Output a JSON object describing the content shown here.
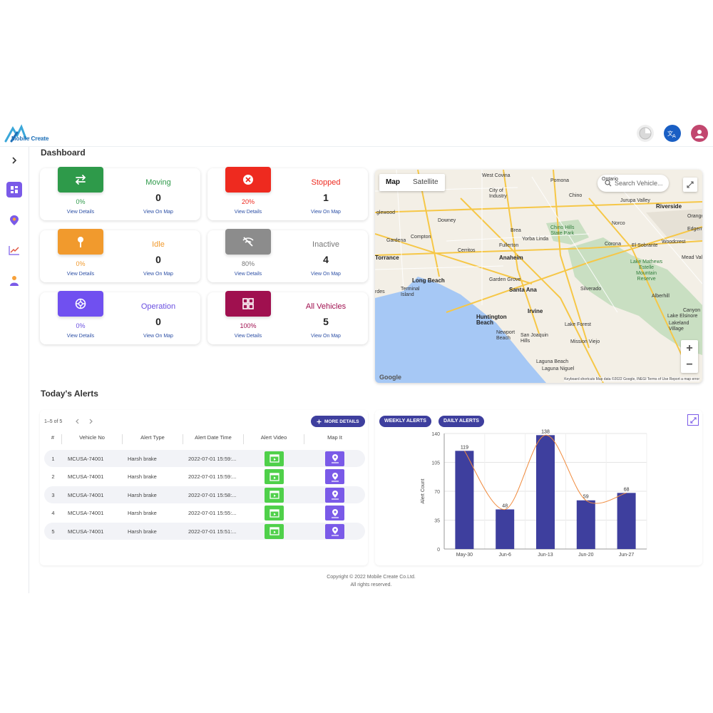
{
  "brand": {
    "name": "Mobile Create",
    "tagline": "— — — — —",
    "accent": "#1e6fb7"
  },
  "header": {
    "icons": [
      "theme-icon",
      "translate-icon",
      "account-icon"
    ]
  },
  "sidebar": {
    "items": [
      "chevron-right-icon",
      "dashboard-icon",
      "location-icon",
      "trend-icon",
      "people-icon"
    ]
  },
  "dashboard": {
    "title": "Dashboard"
  },
  "cards": [
    {
      "label": "Moving",
      "count": "0",
      "percent": "0%",
      "view_details": "View Details",
      "view_map": "View On Map",
      "color": "#2e9a4a",
      "label_color": "#2e9a4a"
    },
    {
      "label": "Stopped",
      "count": "1",
      "percent": "20%",
      "view_details": "View Details",
      "view_map": "View On Map",
      "color": "#ee2a1f",
      "label_color": "#ee2a1f"
    },
    {
      "label": "Idle",
      "count": "0",
      "percent": "0%",
      "view_details": "View Details",
      "view_map": "View On Map",
      "color": "#f19a2d",
      "label_color": "#f19a2d"
    },
    {
      "label": "Inactive",
      "count": "4",
      "percent": "80%",
      "view_details": "View Details",
      "view_map": "View On Map",
      "color": "#8c8c8c",
      "label_color": "#777777"
    },
    {
      "label": "Operation",
      "count": "0",
      "percent": "0%",
      "view_details": "View Details",
      "view_map": "View On Map",
      "color": "#7050f0",
      "label_color": "#6a4fe0"
    },
    {
      "label": "All Vehicles",
      "count": "5",
      "percent": "100%",
      "view_details": "View Details",
      "view_map": "View On Map",
      "color": "#a0104f",
      "label_color": "#a0104f"
    }
  ],
  "map": {
    "type_map": "Map",
    "type_satellite": "Satellite",
    "search_placeholder": "Search Vehicle...",
    "zoom_in": "+",
    "zoom_out": "−",
    "logo": "Google",
    "footer": "Keyboard shortcuts   Map data ©2022 Google, INEGI   Terms of Use   Report a map error",
    "places": {
      "west_covina": "West Covina",
      "pomona": "Pomona",
      "ontario": "Ontario",
      "city_of_industry": "City of\nIndustry",
      "chino": "Chino",
      "jurupa_valley": "Jurupa Valley",
      "riverside": "Riverside",
      "glewood": "glewood",
      "downey": "Downey",
      "brea": "Brea",
      "chino_hills": "Chino Hills\nState Park",
      "norco": "Norco",
      "compton": "Compton",
      "yorba_linda": "Yorba Linda",
      "gardena": "Gardena",
      "fullerton": "Fullerton",
      "corona": "Corona",
      "el_sobrante": "El Sobrante",
      "woodcrest": "Woodcrest",
      "edgemont": "Edgem",
      "torrance": "Torrance",
      "cerritos": "Cerritos",
      "orange_hdr": "Orange",
      "anaheim": "Anaheim",
      "mead_valley": "Mead Val",
      "lake_mathews": "Lake Mathews\nEstelle\nMountain\nReserve",
      "long_beach": "Long Beach",
      "garden_grove": "Garden Grove",
      "silverado": "Silverado",
      "terminal_island": "Terminal\nIsland",
      "santa_ana": "Santa Ana",
      "rdes": "rdes",
      "albehill": "Alberhill",
      "irvine": "Irvine",
      "huntington": "Huntington\nBeach",
      "canyon": "Canyon",
      "lake_elsinore": "Lake Elsinore",
      "lakeland": "Lakeland\nVillage",
      "lake_forest": "Lake Forest",
      "newport": "Newport\nBeach",
      "san_joaquin": "San Joaquin\nHills",
      "mission_viejo": "Mission Viejo",
      "laguna_beach": "Laguna Beach",
      "laguna_niguel": "Laguna Niguel"
    }
  },
  "alerts": {
    "title": "Today's Alerts",
    "pager": "1–5 of 5",
    "more_details": "MORE DETAILS",
    "columns": [
      "#",
      "Vehicle No",
      "Alert Type",
      "Alert Date Time",
      "Alert Video",
      "Map It"
    ],
    "rows": [
      {
        "n": "1",
        "vehicle": "MCUSA-74001",
        "type": "Harsh brake",
        "time": "2022-07-01 15:59:..."
      },
      {
        "n": "2",
        "vehicle": "MCUSA-74001",
        "type": "Harsh brake",
        "time": "2022-07-01 15:59:..."
      },
      {
        "n": "3",
        "vehicle": "MCUSA-74001",
        "type": "Harsh brake",
        "time": "2022-07-01 15:58:..."
      },
      {
        "n": "4",
        "vehicle": "MCUSA-74001",
        "type": "Harsh brake",
        "time": "2022-07-01 15:55:..."
      },
      {
        "n": "5",
        "vehicle": "MCUSA-74001",
        "type": "Harsh brake",
        "time": "2022-07-01 15:51:..."
      }
    ]
  },
  "chart_tabs": {
    "weekly": "WEEKLY ALERTS",
    "daily": "DAILY ALERTS"
  },
  "chart_data": {
    "type": "bar",
    "categories": [
      "May-30",
      "Jun-6",
      "Jun-13",
      "Jun-20",
      "Jun-27"
    ],
    "values": [
      119,
      48,
      138,
      59,
      68
    ],
    "title": "",
    "xlabel": "",
    "ylabel": "Alert Count",
    "ylim": [
      0,
      140
    ],
    "yticks": [
      0,
      35,
      70,
      105,
      140
    ],
    "grid": true,
    "bar_color": "#3e3f9e",
    "trend_line": true,
    "trend_color": "#f08a3c"
  },
  "footer": {
    "line1": "Copyright © 2022 Mobile Create Co.Ltd.",
    "line2": "All rights reserved."
  }
}
